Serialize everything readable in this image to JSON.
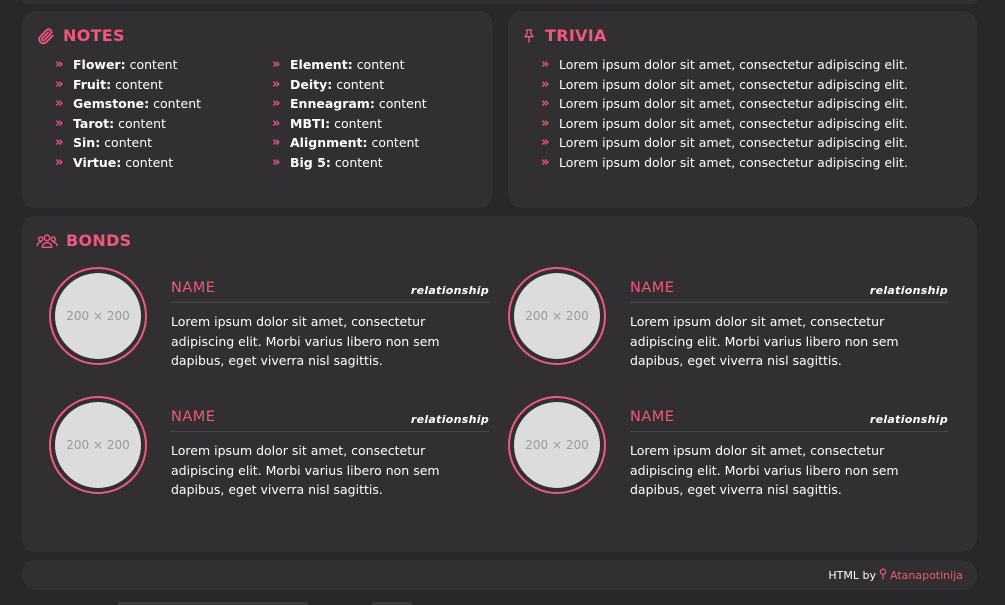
{
  "notes": {
    "title": "NOTES",
    "left": [
      {
        "key": "Flower",
        "value": "content"
      },
      {
        "key": "Fruit",
        "value": "content"
      },
      {
        "key": "Gemstone",
        "value": "content"
      },
      {
        "key": "Tarot",
        "value": "content"
      },
      {
        "key": "Sin",
        "value": "content"
      },
      {
        "key": "Virtue",
        "value": "content"
      }
    ],
    "right": [
      {
        "key": "Element",
        "value": "content"
      },
      {
        "key": "Deity",
        "value": "content"
      },
      {
        "key": "Enneagram",
        "value": "content"
      },
      {
        "key": "MBTI",
        "value": "content"
      },
      {
        "key": "Alignment",
        "value": "content"
      },
      {
        "key": "Big 5",
        "value": "content"
      }
    ]
  },
  "trivia": {
    "title": "TRIVIA",
    "items": [
      "Lorem ipsum dolor sit amet, consectetur adipiscing elit.",
      "Lorem ipsum dolor sit amet, consectetur adipiscing elit.",
      "Lorem ipsum dolor sit amet, consectetur adipiscing elit.",
      "Lorem ipsum dolor sit amet, consectetur adipiscing elit.",
      "Lorem ipsum dolor sit amet, consectetur adipiscing elit.",
      "Lorem ipsum dolor sit amet, consectetur adipiscing elit."
    ]
  },
  "bonds": {
    "title": "BONDS",
    "items": [
      {
        "placeholder": "200 × 200",
        "name": "NAME",
        "relationship": "relationship",
        "description": "Lorem ipsum dolor sit amet, consectetur adipiscing elit. Morbi varius libero non sem dapibus, eget viverra nisl sagittis."
      },
      {
        "placeholder": "200 × 200",
        "name": "NAME",
        "relationship": "relationship",
        "description": "Lorem ipsum dolor sit amet, consectetur adipiscing elit. Morbi varius libero non sem dapibus, eget viverra nisl sagittis."
      },
      {
        "placeholder": "200 × 200",
        "name": "NAME",
        "relationship": "relationship",
        "description": "Lorem ipsum dolor sit amet, consectetur adipiscing elit. Morbi varius libero non sem dapibus, eget viverra nisl sagittis."
      },
      {
        "placeholder": "200 × 200",
        "name": "NAME",
        "relationship": "relationship",
        "description": "Lorem ipsum dolor sit amet, consectetur adipiscing elit. Morbi varius libero non sem dapibus, eget viverra nisl sagittis."
      }
    ]
  },
  "footer": {
    "prefix": "HTML by",
    "author": "Atanapotinija"
  },
  "icons": {
    "notes": "paperclip-icon",
    "trivia": "pushpin-icon",
    "bonds": "users-icon",
    "bullet": "double-chevron-right-icon",
    "footer": "map-pin-icon"
  },
  "colors": {
    "accent": "#f0587e",
    "background": "#29272a",
    "panel": "#322f32",
    "text": "#ffffff"
  }
}
